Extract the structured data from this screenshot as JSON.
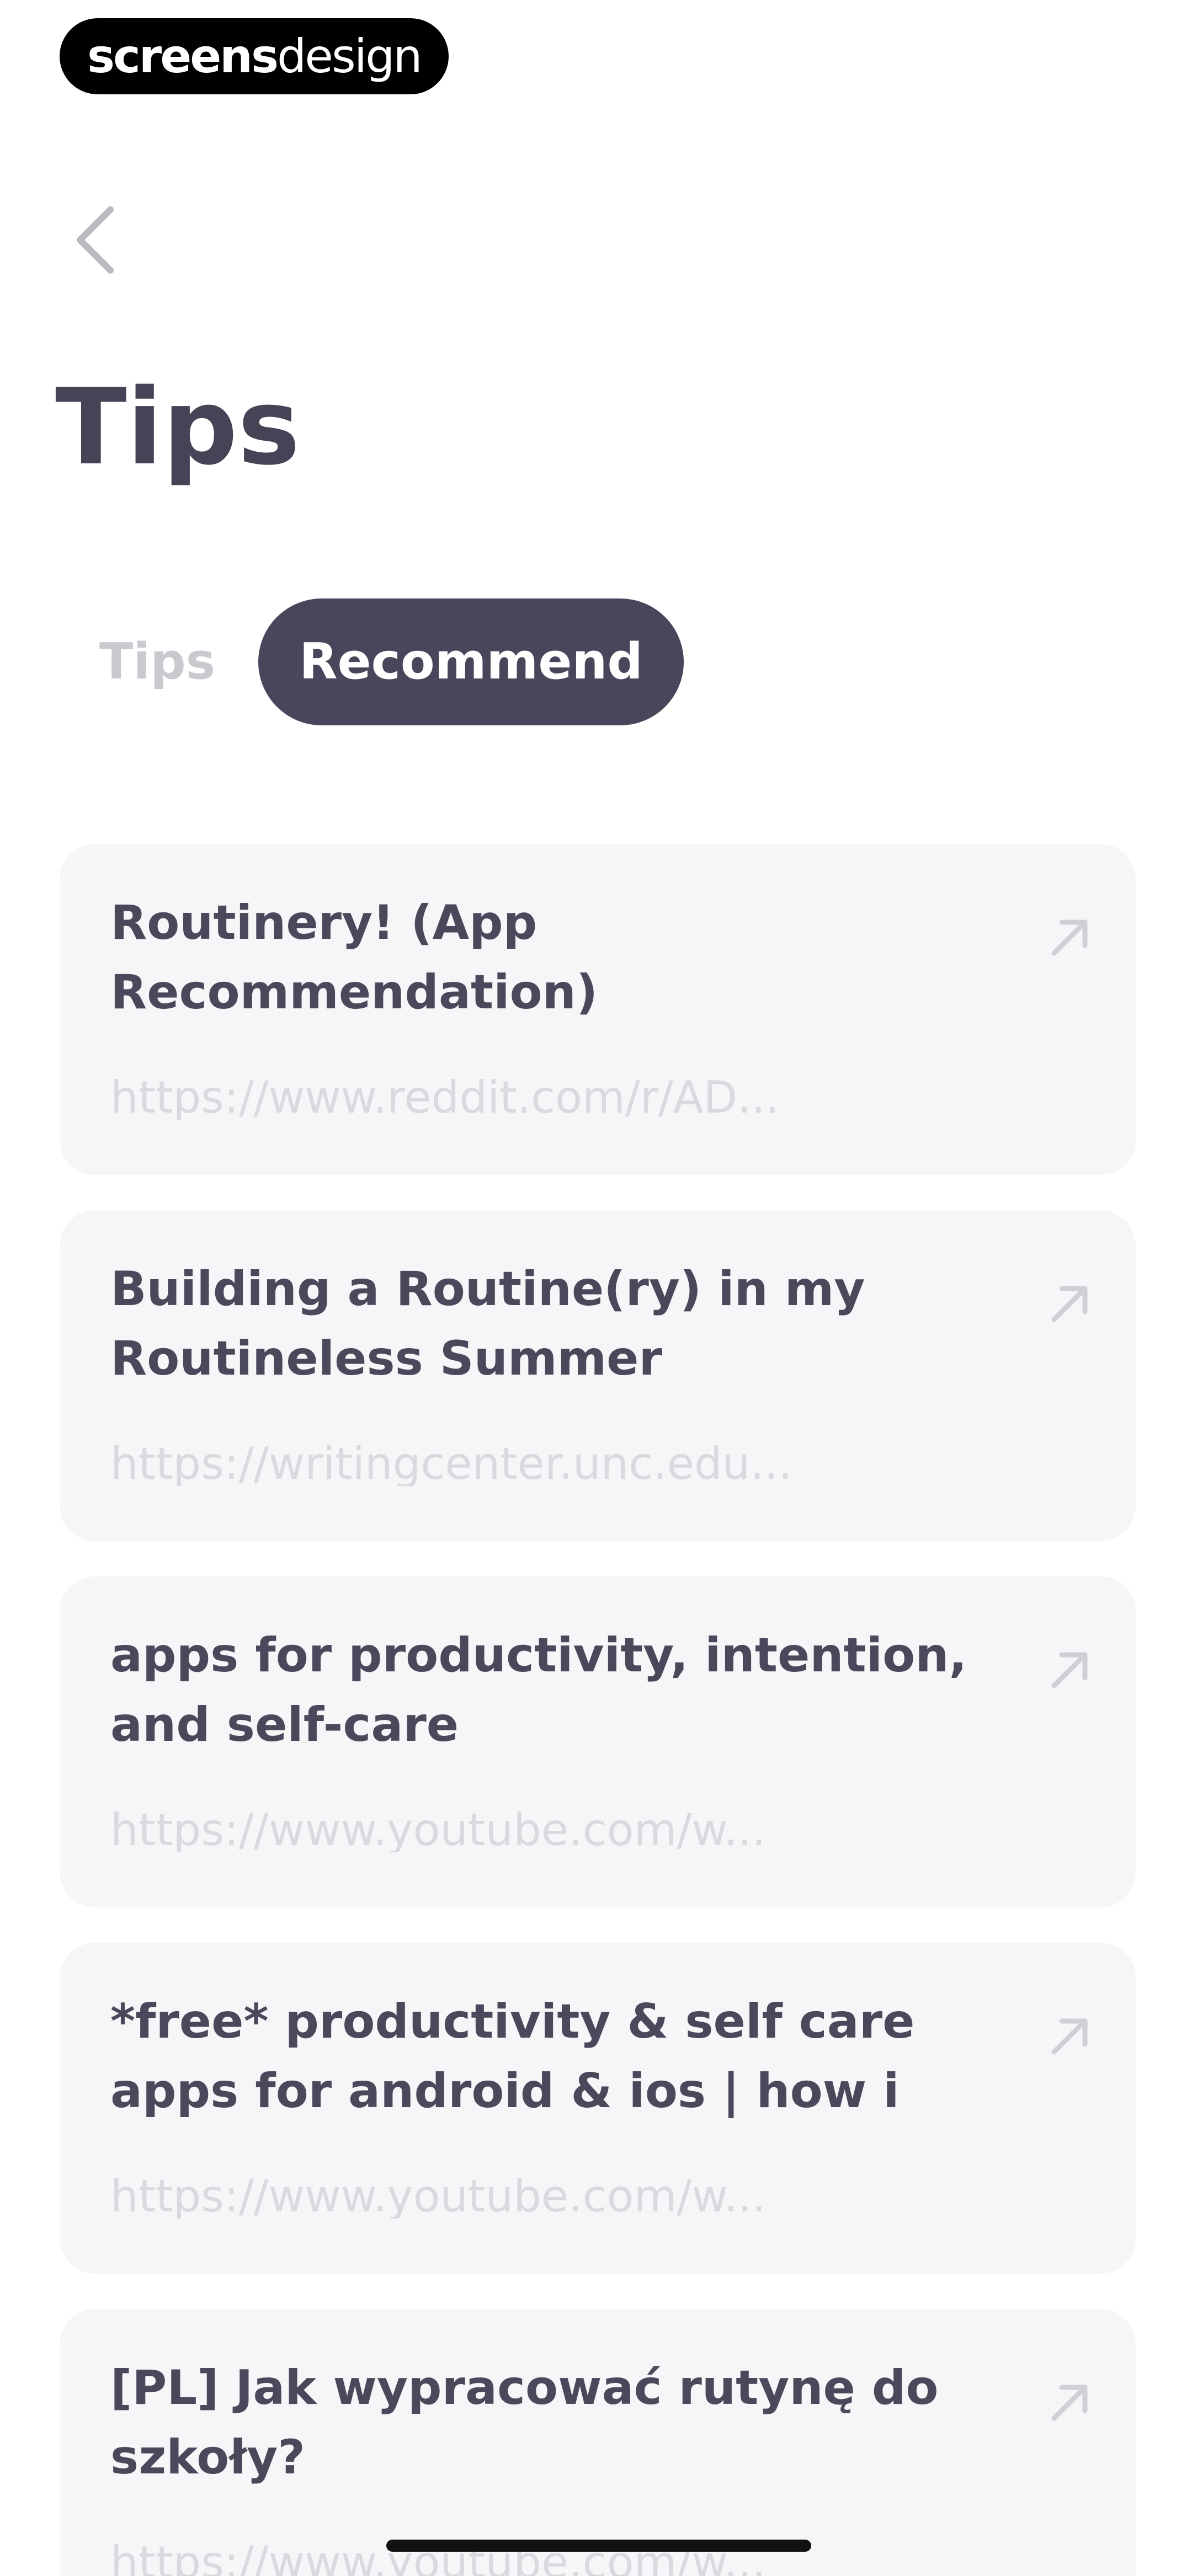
{
  "watermark": {
    "part1": "screens",
    "part2": "design"
  },
  "header": {
    "title": "Tips"
  },
  "tabs": [
    {
      "label": "Tips",
      "active": false
    },
    {
      "label": "Recommend",
      "active": true
    }
  ],
  "items": [
    {
      "title": "Routinery! (App Recommendation)",
      "url": "https://www.reddit.com/r/AD..."
    },
    {
      "title": "Building a Routine(ry) in my Routineless Summer",
      "url": "https://writingcenter.unc.edu..."
    },
    {
      "title": "apps for productivity, intention, and self-care",
      "url": "https://www.youtube.com/w..."
    },
    {
      "title": "*free* productivity & self care apps for android & ios | how i u...",
      "url": "https://www.youtube.com/w..."
    },
    {
      "title": "[PL] Jak wypracować rutynę do szkoły?",
      "url": "https://www.youtube.com/w..."
    }
  ],
  "colors": {
    "text": "#46465a",
    "active_tab_bg": "#47465a",
    "card_bg": "#f6f6f8",
    "muted": "#c9c9cf"
  },
  "icons": {
    "back": "chevron-left-icon",
    "open": "arrow-up-right-icon"
  }
}
